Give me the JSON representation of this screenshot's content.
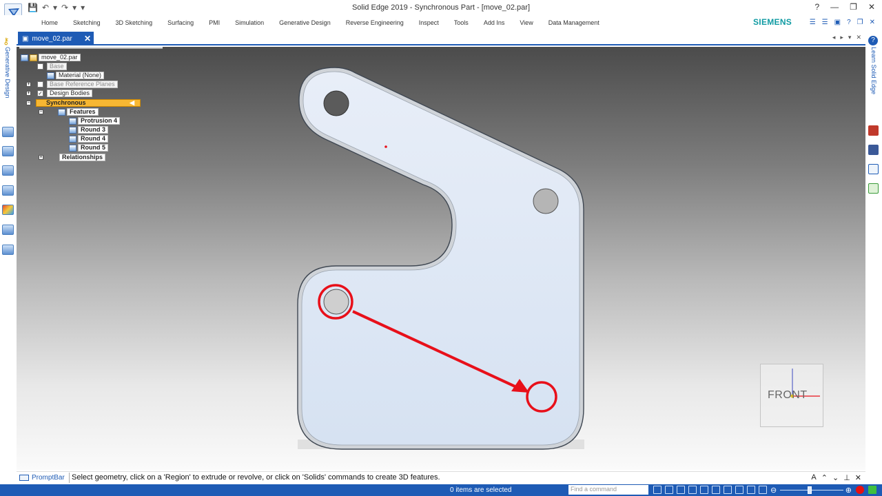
{
  "window": {
    "title": "Solid Edge 2019 - Synchronous Part - [move_02.par]",
    "controls": [
      "?",
      "—",
      "❐",
      "✕"
    ]
  },
  "ribbon": {
    "tabs": [
      "Home",
      "Sketching",
      "3D Sketching",
      "Surfacing",
      "PMI",
      "Simulation",
      "Generative Design",
      "Reverse Engineering",
      "Inspect",
      "Tools",
      "Add Ins",
      "View",
      "Data Management"
    ],
    "brand": "SIEMENS"
  },
  "document": {
    "tab_label": "move_02.par",
    "close": "✕"
  },
  "leftbar": {
    "generative_label": "Generative Design"
  },
  "rightbar": {
    "learn_label": "Learn Solid Edge"
  },
  "tree": {
    "root": "move_02.par",
    "base": "Base",
    "material": "Material (None)",
    "ref_planes": "Base Reference Planes",
    "design_bodies": "Design Bodies",
    "synchronous": "Synchronous",
    "features": "Features",
    "items": [
      "Protrusion 4",
      "Round 3",
      "Round 4",
      "Round 5"
    ],
    "relationships": "Relationships",
    "design_bodies_checked": true
  },
  "viewcube": {
    "label": "FRONT"
  },
  "prompt": {
    "label": "PromptBar",
    "text": "Select geometry, click on a 'Region' to extrude or revolve, or click on 'Solids' commands to create 3D features."
  },
  "status": {
    "selection": "0 items are selected",
    "find_placeholder": "Find a command"
  },
  "colors": {
    "accent": "#1e5bb5",
    "brand": "#109ba3",
    "highlight": "#f7b733",
    "annotation": "#e8101a"
  }
}
